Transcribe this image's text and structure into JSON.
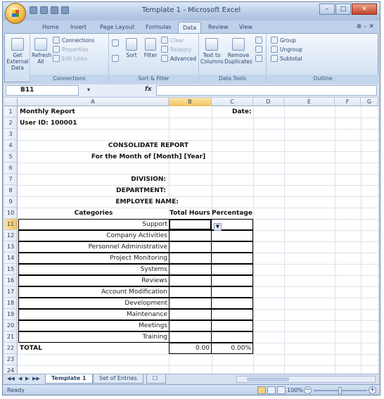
{
  "window": {
    "title": "Template 1 - Microsoft Excel"
  },
  "ribbon_tabs": [
    "Home",
    "Insert",
    "Page Layout",
    "Formulas",
    "Data",
    "Review",
    "View"
  ],
  "ribbon": {
    "get_external_data": "Get External Data",
    "refresh_all": "Refresh All",
    "connections_items": [
      "Connections",
      "Properties",
      "Edit Links"
    ],
    "connections_group": "Connections",
    "sort_label": "Sort",
    "filter_label": "Filter",
    "filter_items": [
      "Clear",
      "Reapply",
      "Advanced"
    ],
    "sort_filter_group": "Sort & Filter",
    "text_to_columns": "Text to Columns",
    "remove_duplicates": "Remove Duplicates",
    "data_tools_group": "Data Tools",
    "outline_items": [
      "Group",
      "Ungroup",
      "Subtotal"
    ],
    "outline_group": "Outline"
  },
  "formula_bar": {
    "name_box": "B11",
    "fx": "fx",
    "formula": ""
  },
  "columns": [
    "A",
    "B",
    "C",
    "D",
    "E",
    "F",
    "G"
  ],
  "selected_column": "B",
  "selected_row": "11",
  "rows": [
    "1",
    "2",
    "3",
    "4",
    "5",
    "6",
    "7",
    "8",
    "9",
    "10",
    "11",
    "12",
    "13",
    "14",
    "15",
    "16",
    "17",
    "18",
    "19",
    "20",
    "21",
    "22",
    "23",
    "24"
  ],
  "sheet": {
    "monthly_report": "Monthly Report",
    "date_label": "Date:",
    "user_id": "User ID: 100001",
    "consolidate_report": "CONSOLIDATE REPORT",
    "for_month": "For the Month of [Month] [Year]",
    "division": "DIVISION:",
    "department": "DEPARTMENT:",
    "employee_name": "EMPLOYEE NAME:",
    "table_headers": {
      "categories": "Categories",
      "total_hours": "Total Hours",
      "percentage": "Percentage"
    },
    "categories": [
      "Support",
      "Company Activities",
      "Personnel Administrative",
      "Project Monitoring",
      "Systems",
      "Reviews",
      "Account Modification",
      "Development",
      "Maintenance",
      "Meetings",
      "Training"
    ],
    "total_label": "TOTAL",
    "total_hours": "0.00",
    "total_percentage": "0.00%"
  },
  "sheet_tabs": [
    "Template 1",
    "Set of Entries"
  ],
  "active_sheet": "Template 1",
  "status": {
    "text": "Ready",
    "zoom": "100%"
  }
}
